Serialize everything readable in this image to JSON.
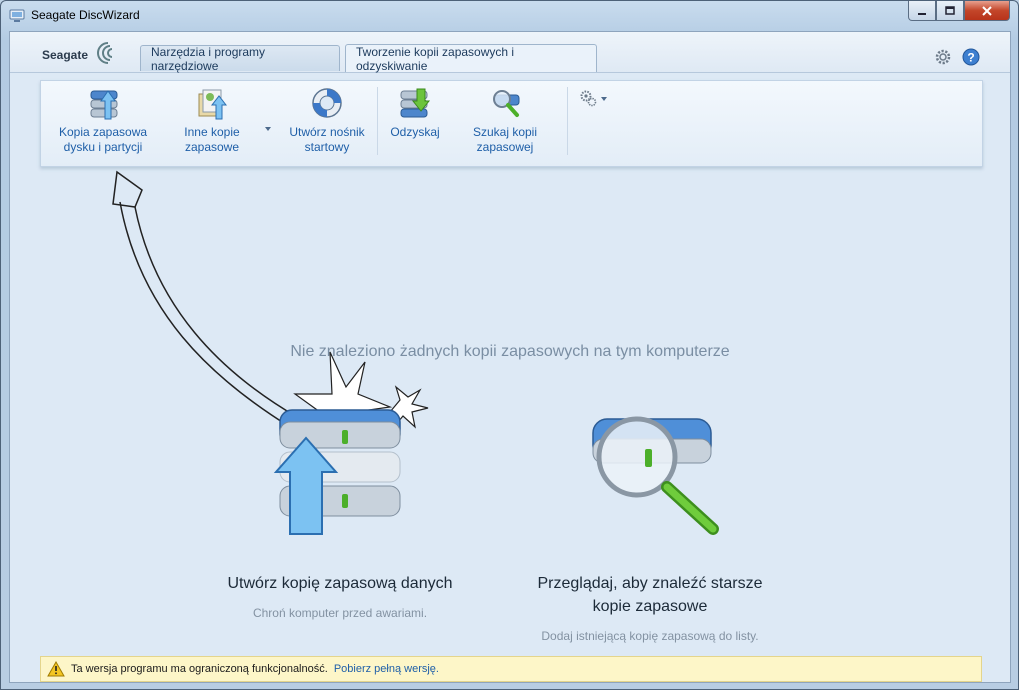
{
  "window": {
    "title": "Seagate DiscWizard"
  },
  "header": {
    "logo_text": "Seagate",
    "tabs": [
      {
        "label": "Narzędzia i programy narzędziowe",
        "active": false
      },
      {
        "label": "Tworzenie kopii zapasowych i odzyskiwanie",
        "active": true
      }
    ]
  },
  "ribbon": {
    "buttons": [
      {
        "line1": "Kopia zapasowa",
        "line2": "dysku i partycji"
      },
      {
        "line1": "Inne kopie",
        "line2": "zapasowe"
      },
      {
        "line1": "Utwórz nośnik",
        "line2": "startowy"
      },
      {
        "line1": "Odzyskaj",
        "line2": ""
      },
      {
        "line1": "Szukaj kopii",
        "line2": "zapasowej"
      }
    ]
  },
  "main": {
    "empty_message": "Nie znaleziono żadnych kopii zapasowych na tym komputerze",
    "backup": {
      "title": "Utwórz kopię zapasową danych",
      "subtitle": "Chroń komputer przed awariami."
    },
    "browse": {
      "title_line1": "Przeglądaj, aby znaleźć starsze",
      "title_line2": "kopie zapasowe",
      "subtitle": "Dodaj istniejącą kopię zapasową do listy."
    }
  },
  "warning": {
    "text": "Ta wersja programu ma ograniczoną funkcjonalność.",
    "link": "Pobierz pełną wersję."
  },
  "colors": {
    "link": "#1f5fa8",
    "warning_bg": "#fdf6c8",
    "accent_blue": "#3a78c9",
    "accent_green": "#4caf2a"
  }
}
